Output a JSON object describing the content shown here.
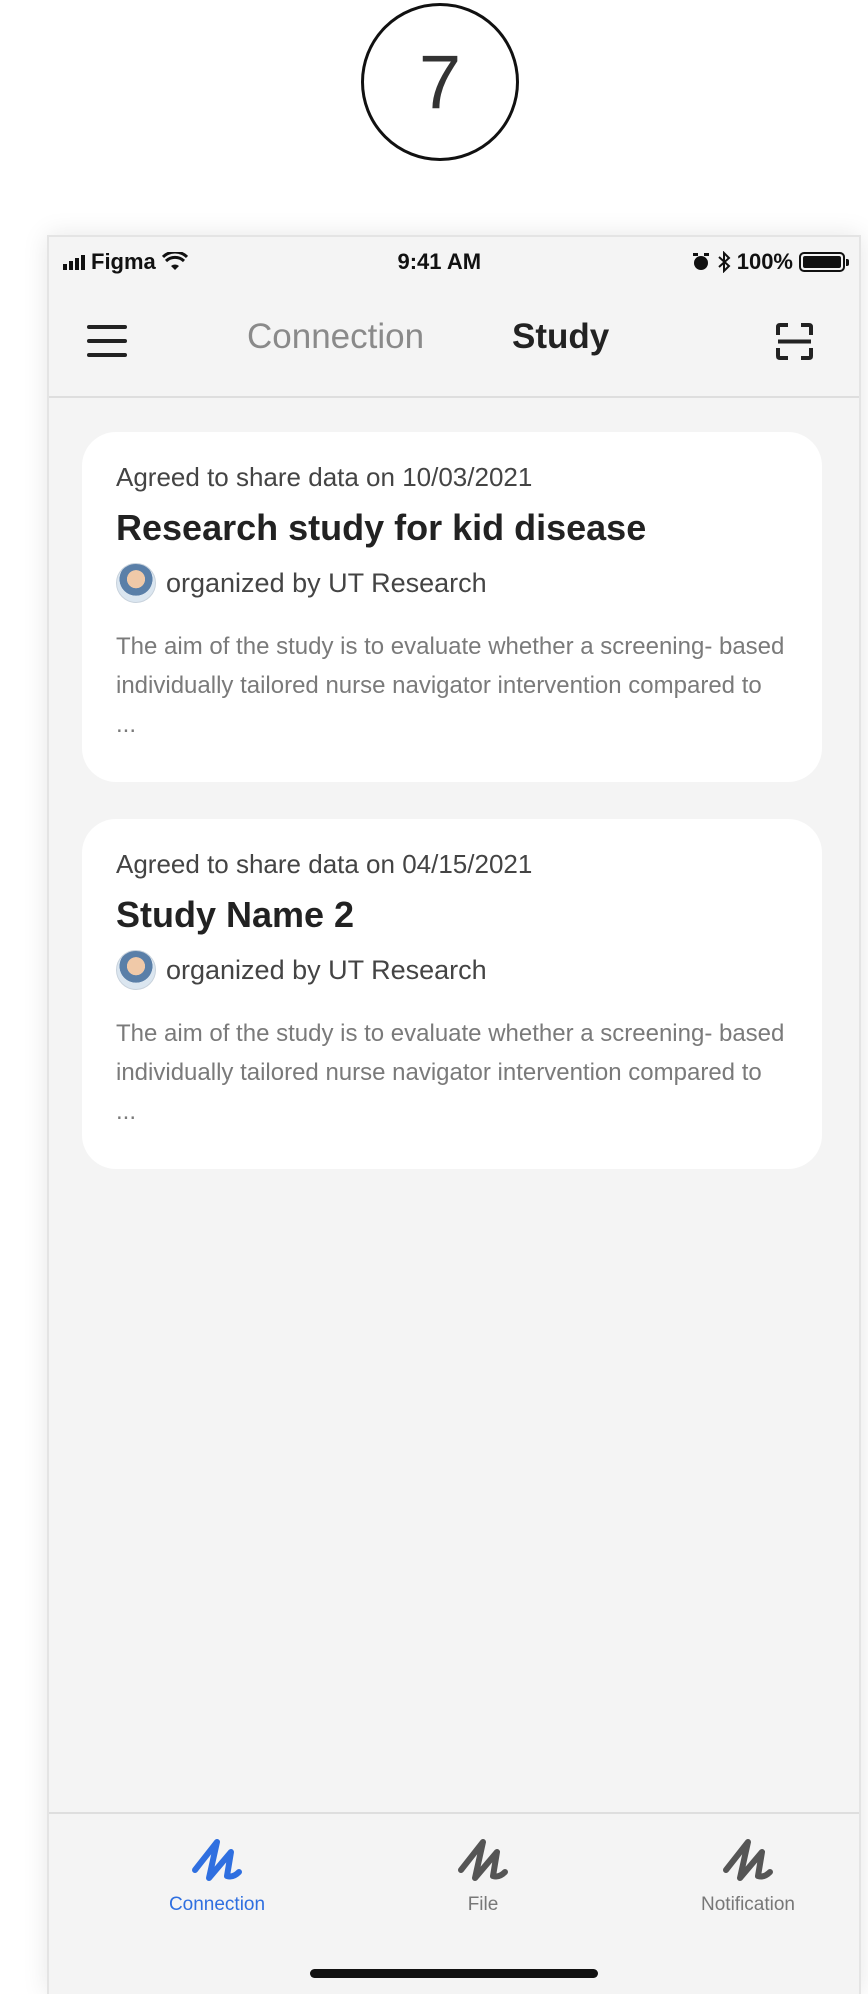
{
  "step_number": "7",
  "status_bar": {
    "carrier": "Figma",
    "time": "9:41 AM",
    "battery": "100%",
    "icons": [
      "signal-icon",
      "wifi-icon",
      "alarm-icon",
      "bluetooth-icon",
      "battery-icon"
    ]
  },
  "nav": {
    "tabs": [
      "Connection",
      "Study"
    ],
    "active_tab": "Study",
    "menu_icon": "hamburger-menu-icon",
    "scan_icon": "qr-scan-icon"
  },
  "studies": [
    {
      "agreed": "Agreed to share data on 10/03/2021",
      "title": "Research study for kid disease",
      "organizer": "organized by UT Research",
      "description": "The aim of the study is to evaluate whether a screening- based individually tailored nurse navigator intervention compared to ..."
    },
    {
      "agreed": "Agreed to share data on 04/15/2021",
      "title": "Study Name 2",
      "organizer": "organized by UT Research",
      "description": "The aim of the study is to evaluate whether a screening- based individually tailored nurse navigator intervention compared to ..."
    }
  ],
  "tab_bar": {
    "items": [
      {
        "label": "Connection",
        "icon": "connection-icon",
        "active": true
      },
      {
        "label": "File",
        "icon": "file-icon",
        "active": false
      },
      {
        "label": "Notification",
        "icon": "notification-icon",
        "active": false
      }
    ]
  },
  "colors": {
    "active": "#2f6fe0",
    "inactive": "#777777",
    "background": "#f4f4f4",
    "card": "#ffffff"
  }
}
